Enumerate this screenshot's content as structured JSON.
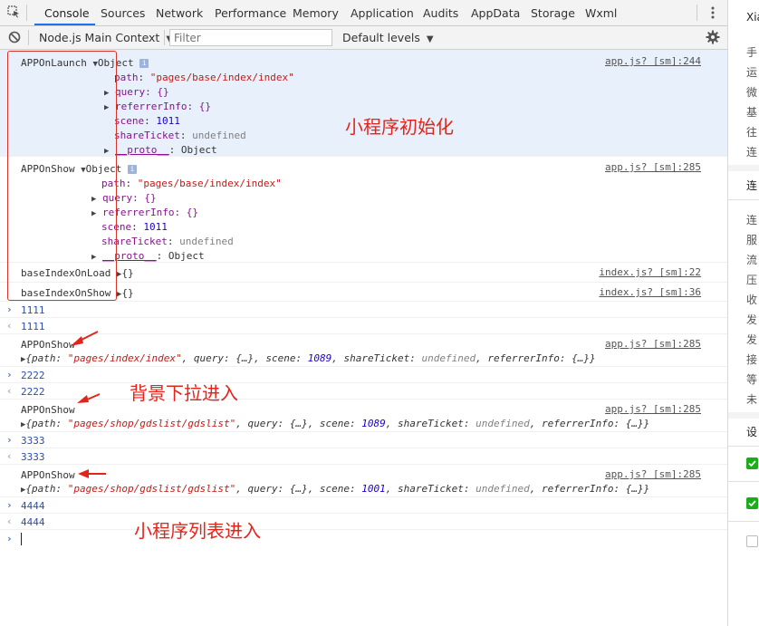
{
  "tabs": [
    "Console",
    "Sources",
    "Network",
    "Performance",
    "Memory",
    "Application",
    "Audits",
    "AppData",
    "Storage",
    "Wxml"
  ],
  "toolbar": {
    "context": "Node.js Main Context",
    "filter_placeholder": "Filter",
    "levels": "Default levels"
  },
  "console": {
    "launch": {
      "label": "APPOnLaunch",
      "object": "Object",
      "source": "app.js? [sm]:244",
      "path_key": "path",
      "path_val": "\"pages/base/index/index\"",
      "query": "query: {}",
      "referrer": "referrerInfo: {}",
      "scene_key": "scene",
      "scene_val": "1011",
      "share_key": "shareTicket",
      "share_val": "undefined",
      "proto_key": "__proto__",
      "proto_val": "Object"
    },
    "show1": {
      "label": "APPOnShow",
      "object": "Object",
      "source": "app.js? [sm]:285",
      "path_key": "path",
      "path_val": "\"pages/base/index/index\"",
      "query": "query: {}",
      "referrer": "referrerInfo: {}",
      "scene_key": "scene",
      "scene_val": "1011",
      "share_key": "shareTicket",
      "share_val": "undefined",
      "proto_key": "__proto__",
      "proto_val": "Object"
    },
    "onload": {
      "label": "baseIndexOnLoad",
      "val": "{}",
      "source": "index.js? [sm]:22"
    },
    "onshow": {
      "label": "baseIndexOnShow",
      "val": "{}",
      "source": "index.js? [sm]:36"
    },
    "in1": "1111",
    "out1": "1111",
    "show2": {
      "label": "APPOnShow",
      "source": "app.js? [sm]:285",
      "path": "\"pages/index/index\"",
      "scene": "1089"
    },
    "in2": "2222",
    "out2": "2222",
    "show3": {
      "label": "APPOnShow",
      "source": "app.js? [sm]:285",
      "path": "\"pages/shop/gdslist/gdslist\"",
      "scene": "1089"
    },
    "in3": "3333",
    "out3": "3333",
    "show4": {
      "label": "APPOnShow",
      "source": "app.js? [sm]:285",
      "path": "\"pages/shop/gdslist/gdslist\"",
      "scene": "1001"
    },
    "in4": "4444",
    "out4": "4444",
    "obj_path_key": "{path: ",
    "obj_mid": ", query: {…}, scene: ",
    "obj_share": ", shareTicket: ",
    "obj_undef": "undefined",
    "obj_end": ", referrerInfo: {…}}"
  },
  "annotations": {
    "init": "小程序初始化",
    "bg": "背景下拉进入",
    "list": "小程序列表进入"
  },
  "right_panel": {
    "title": "Xia",
    "items": [
      "手",
      "运",
      "微",
      "基",
      "往",
      "连"
    ],
    "section2": "连",
    "items2": [
      "连",
      "服",
      "流",
      "压",
      "收",
      "发",
      "发",
      "接",
      "等",
      "未"
    ],
    "section3": "设"
  },
  "colors": {
    "accent": "#1a73e8",
    "annotation": "#e3241b",
    "checkbox": "#1aad19"
  }
}
